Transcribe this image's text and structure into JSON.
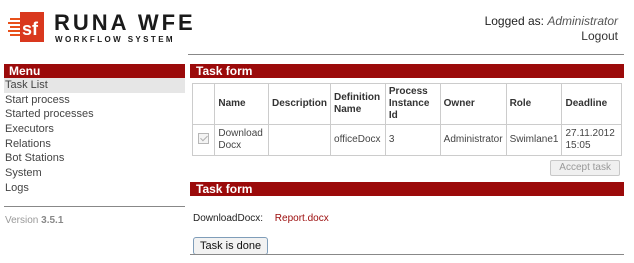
{
  "header": {
    "logo_title": "RUNA WFE",
    "logo_subtitle": "WORKFLOW SYSTEM",
    "logged_as_label": "Logged as:",
    "user_name": "Administrator",
    "logout_label": "Logout"
  },
  "sidebar": {
    "title": "Menu",
    "items": [
      {
        "label": "Task List"
      },
      {
        "label": "Start process"
      },
      {
        "label": "Started processes"
      },
      {
        "label": "Executors"
      },
      {
        "label": "Relations"
      },
      {
        "label": "Bot Stations"
      },
      {
        "label": "System"
      },
      {
        "label": "Logs"
      }
    ],
    "version_label": "Version",
    "version_number": "3.5.1"
  },
  "task_section": {
    "title": "Task form",
    "columns": [
      "",
      "Name",
      "Description",
      "Definition Name",
      "Process Instance Id",
      "Owner",
      "Role",
      "Deadline"
    ],
    "rows": [
      {
        "name": "Download Docx",
        "description": "",
        "definition_name": "officeDocx",
        "process_instance_id": "3",
        "owner": "Administrator",
        "role": "Swimlane1",
        "deadline": "27.11.2012 15:05"
      }
    ],
    "accept_button": "Accept task"
  },
  "form_section": {
    "title": "Task form",
    "field_label": "DownloadDocx:",
    "field_value": "Report.docx",
    "done_button": "Task is done"
  },
  "colors": {
    "accent": "#9b0a0a",
    "logo_orange": "#e8501a"
  }
}
